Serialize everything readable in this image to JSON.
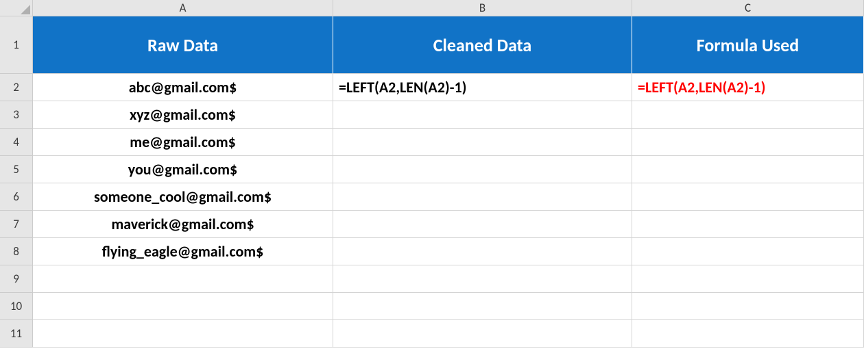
{
  "columns": [
    "A",
    "B",
    "C"
  ],
  "rowNumbers": [
    "1",
    "2",
    "3",
    "4",
    "5",
    "6",
    "7",
    "8",
    "9",
    "10",
    "11"
  ],
  "headers": {
    "A": "Raw Data",
    "B": "Cleaned Data",
    "C": "Formula Used"
  },
  "rows": [
    {
      "A": "abc@gmail.com$",
      "B": "=LEFT(A2,LEN(A2)-1)",
      "C": "=LEFT(A2,LEN(A2)-1)"
    },
    {
      "A": "xyz@gmail.com$",
      "B": "",
      "C": ""
    },
    {
      "A": "me@gmail.com$",
      "B": "",
      "C": ""
    },
    {
      "A": "you@gmail.com$",
      "B": "",
      "C": ""
    },
    {
      "A": "someone_cool@gmail.com$",
      "B": "",
      "C": ""
    },
    {
      "A": "maverick@gmail.com$",
      "B": "",
      "C": ""
    },
    {
      "A": "flying_eagle@gmail.com$",
      "B": "",
      "C": ""
    },
    {
      "A": "",
      "B": "",
      "C": ""
    },
    {
      "A": "",
      "B": "",
      "C": ""
    },
    {
      "A": "",
      "B": "",
      "C": ""
    }
  ],
  "colors": {
    "headerFill": "#1173c7",
    "headerText": "#ffffff",
    "formulaHighlight": "#ff0000"
  }
}
